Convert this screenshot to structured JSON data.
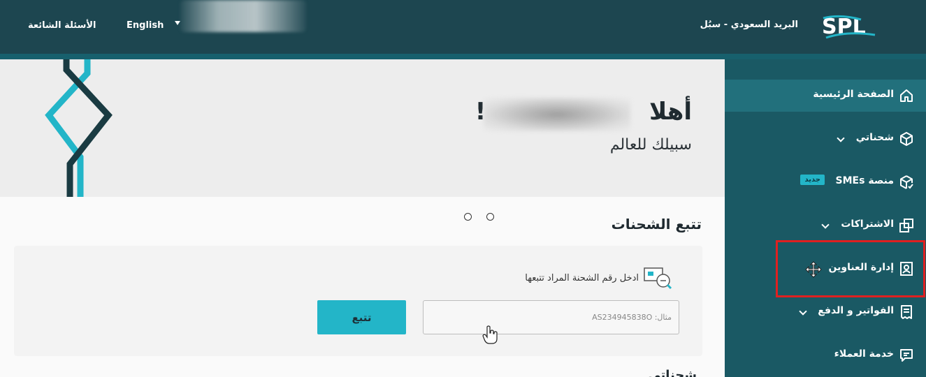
{
  "header": {
    "logo_text": "SPL",
    "brand_name": "البريد السعودي - سبُل",
    "language_link": "English",
    "faq_link": "الأسئلة الشائعة"
  },
  "sidebar": {
    "items": [
      {
        "label": "الصفحة الرئيسية",
        "icon": "home-icon"
      },
      {
        "label": "شحناتي",
        "icon": "box-icon"
      },
      {
        "label": "منصة SMEs",
        "icon": "package-check-icon",
        "badge": "جديد"
      },
      {
        "label": "الاشتراكات",
        "icon": "copy-icon"
      },
      {
        "label": "إدارة العناوين",
        "icon": "contact-card-icon"
      },
      {
        "label": "الفواتير و الدفع",
        "icon": "receipt-icon"
      },
      {
        "label": "خدمة العملاء",
        "icon": "chat-icon"
      }
    ]
  },
  "hero": {
    "greeting": "أهلا",
    "greeting_end": "!",
    "subtitle": "سبيلك للعالم"
  },
  "tracking": {
    "title": "تتبع الشحنات",
    "hint": "ادخل رقم الشحنة المراد تتبعها",
    "placeholder": "مثال: AS234945838O",
    "button_label": "تتبع",
    "next_section_title": "شحناتي"
  },
  "colors": {
    "header_bg": "#1d4650",
    "sidebar_bg": "#1a5964",
    "accent": "#23b5c8",
    "highlight": "#e02020"
  }
}
